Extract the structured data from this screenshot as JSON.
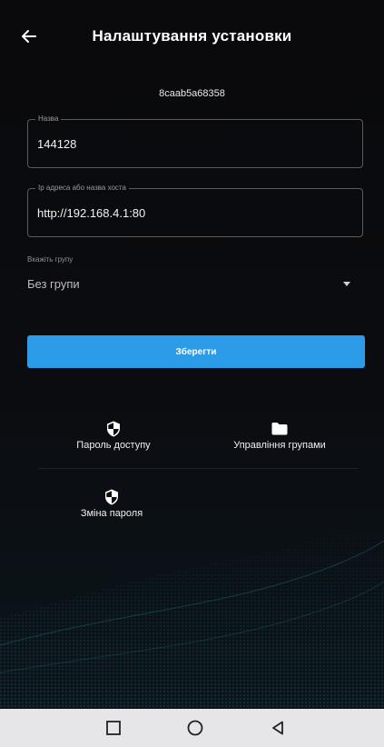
{
  "header": {
    "title": "Налаштування установки",
    "back_icon": "arrow-left-icon"
  },
  "device": {
    "id": "8caab5a68358"
  },
  "fields": {
    "name": {
      "label": "Назва",
      "value": "144128"
    },
    "host": {
      "label": "Ip адреса або назва хоста",
      "value": "http://192.168.4.1:80"
    }
  },
  "group_select": {
    "label": "Вкажіть групу",
    "selected": "Без групи"
  },
  "save_button": {
    "label": "Зберегти"
  },
  "actions": [
    {
      "label": "Пароль доступу",
      "icon": "shield-icon"
    },
    {
      "label": "Управління групами",
      "icon": "folder-icon"
    },
    {
      "label": "Зміна пароля",
      "icon": "shield-icon"
    }
  ],
  "colors": {
    "accent": "#2c9be8",
    "background": "#0a0a0c",
    "navbar": "#e6e6e8"
  },
  "navbar": {
    "buttons": [
      "recents-square-icon",
      "home-circle-icon",
      "back-triangle-icon"
    ]
  }
}
